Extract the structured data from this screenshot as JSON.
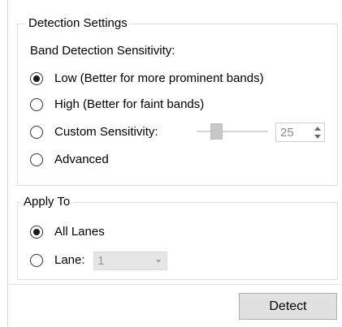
{
  "detection_settings": {
    "legend": "Detection Settings",
    "sensitivity_label": "Band Detection Sensitivity:",
    "options": [
      {
        "label": "Low (Better for more prominent bands)",
        "checked": true
      },
      {
        "label": "High (Better for faint bands)",
        "checked": false
      },
      {
        "label": "Custom Sensitivity:",
        "checked": false
      },
      {
        "label": "Advanced",
        "checked": false
      }
    ],
    "custom_value": "25"
  },
  "apply_to": {
    "legend": "Apply To",
    "options": [
      {
        "label": "All Lanes",
        "checked": true
      },
      {
        "label": "Lane:",
        "checked": false
      }
    ],
    "lane_selected": "1"
  },
  "actions": {
    "detect_label": "Detect"
  },
  "colors": {
    "group_border": "#dcdcdc",
    "button_face": "#e1e1e1",
    "disabled_text": "#9a9a9a"
  }
}
